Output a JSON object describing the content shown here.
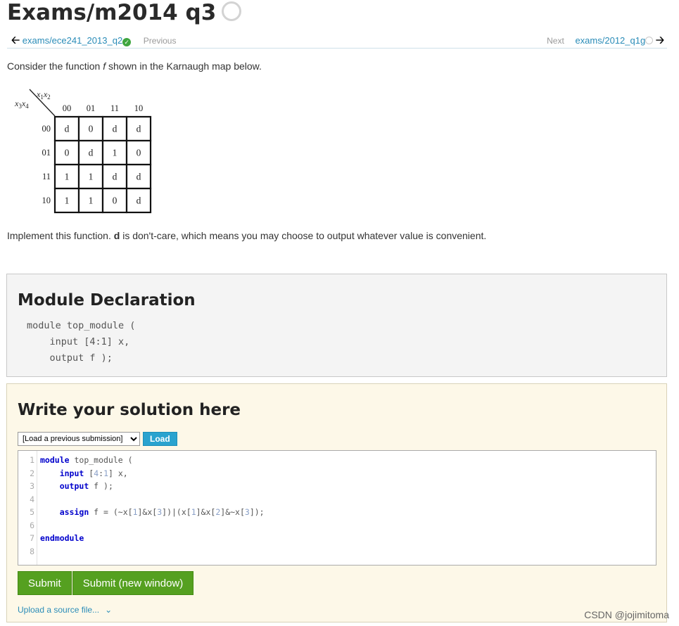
{
  "title": "Exams/m2014 q3",
  "nav": {
    "prev_link": "exams/ece241_2013_q2",
    "prev_label": "Previous",
    "next_label": "Next",
    "next_link": "exams/2012_q1g"
  },
  "intro": {
    "before": "Consider the function ",
    "fn": "f",
    "after": " shown in the Karnaugh map below."
  },
  "kmap": {
    "row_var": [
      "x",
      "3",
      "x",
      "4"
    ],
    "col_var": [
      "x",
      "1",
      "x",
      "2"
    ],
    "col_headers": [
      "00",
      "01",
      "11",
      "10"
    ],
    "row_headers": [
      "00",
      "01",
      "11",
      "10"
    ],
    "cells": [
      [
        "d",
        "0",
        "d",
        "d"
      ],
      [
        "0",
        "d",
        "1",
        "0"
      ],
      [
        "1",
        "1",
        "d",
        "d"
      ],
      [
        "1",
        "1",
        "0",
        "d"
      ]
    ]
  },
  "implement": {
    "before": "Implement this function. ",
    "bold": "d",
    "after": " is don't-care, which means you may choose to output whatever value is convenient."
  },
  "declaration": {
    "heading": "Module Declaration",
    "code": "module top_module (\n    input [4:1] x,\n    output f );"
  },
  "solution": {
    "heading": "Write your solution here",
    "select_value": "[Load a previous submission]",
    "load_label": "Load",
    "submit_label": "Submit",
    "submit_new_label": "Submit (new window)",
    "upload_label": "Upload a source file...",
    "line_numbers": [
      "1",
      "2",
      "3",
      "4",
      "5",
      "6",
      "7",
      "8"
    ],
    "code_lines": [
      [
        {
          "t": "module",
          "c": "kw"
        },
        {
          "t": " top_module ("
        }
      ],
      [
        {
          "t": "    "
        },
        {
          "t": "input",
          "c": "kw"
        },
        {
          "t": " ["
        },
        {
          "t": "4",
          "c": "num"
        },
        {
          "t": ":"
        },
        {
          "t": "1",
          "c": "num"
        },
        {
          "t": "] x,"
        }
      ],
      [
        {
          "t": "    "
        },
        {
          "t": "output",
          "c": "kw"
        },
        {
          "t": " f );"
        }
      ],
      [
        {
          "t": ""
        }
      ],
      [
        {
          "t": "    "
        },
        {
          "t": "assign",
          "c": "kw"
        },
        {
          "t": " f = (~x["
        },
        {
          "t": "1",
          "c": "num"
        },
        {
          "t": "]&x["
        },
        {
          "t": "3",
          "c": "num"
        },
        {
          "t": "])|(x["
        },
        {
          "t": "1",
          "c": "num"
        },
        {
          "t": "]&x["
        },
        {
          "t": "2",
          "c": "num"
        },
        {
          "t": "]&~x["
        },
        {
          "t": "3",
          "c": "num"
        },
        {
          "t": "]);"
        }
      ],
      [
        {
          "t": ""
        }
      ],
      [
        {
          "t": "endmodule",
          "c": "kw"
        }
      ],
      [
        {
          "t": ""
        }
      ]
    ]
  },
  "watermark": "CSDN @jojimitoma",
  "colors": {
    "link": "#2a8cb8",
    "submit": "#55a020",
    "load": "#2aa3cf",
    "solution_bg": "#fdf8e8"
  }
}
